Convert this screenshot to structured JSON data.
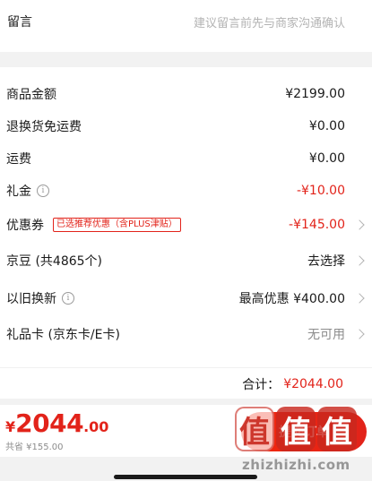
{
  "note": {
    "label": "留言",
    "placeholder": "建议留言前先与商家沟通确认"
  },
  "rows": {
    "goods_amount": {
      "label": "商品金额",
      "value": "¥2199.00"
    },
    "return_shipping": {
      "label": "退换货免运费",
      "value": "¥0.00"
    },
    "shipping": {
      "label": "运费",
      "value": "¥0.00"
    },
    "gift_money": {
      "label": "礼金",
      "value": "-¥10.00"
    },
    "coupon": {
      "label": "优惠券",
      "tag": "已选推荐优惠（含PLUS津贴）",
      "value": "-¥145.00"
    },
    "jingdou": {
      "label": "京豆 (共4865个)",
      "value": "去选择"
    },
    "trade_in": {
      "label": "以旧换新",
      "value": "最高优惠 ¥400.00"
    },
    "gift_card": {
      "label": "礼品卡 (京东卡/E卡)",
      "value": "无可用"
    }
  },
  "total": {
    "label": "合计：",
    "amount": "¥2044.00"
  },
  "bottom": {
    "currency": "¥",
    "price_int": "2044",
    "price_dec": ".00",
    "saved": "共省 ¥155.00",
    "submit_label": "提交订单"
  },
  "watermark": {
    "glyphs": [
      "值",
      "值",
      "值"
    ],
    "text": "zhizhizhi.com"
  },
  "colors": {
    "accent": "#e2231a",
    "muted": "#8c8c8c",
    "background": "#f2f2f2"
  },
  "icons": {
    "info": "info-circle-icon",
    "chevron": "chevron-right-icon"
  }
}
